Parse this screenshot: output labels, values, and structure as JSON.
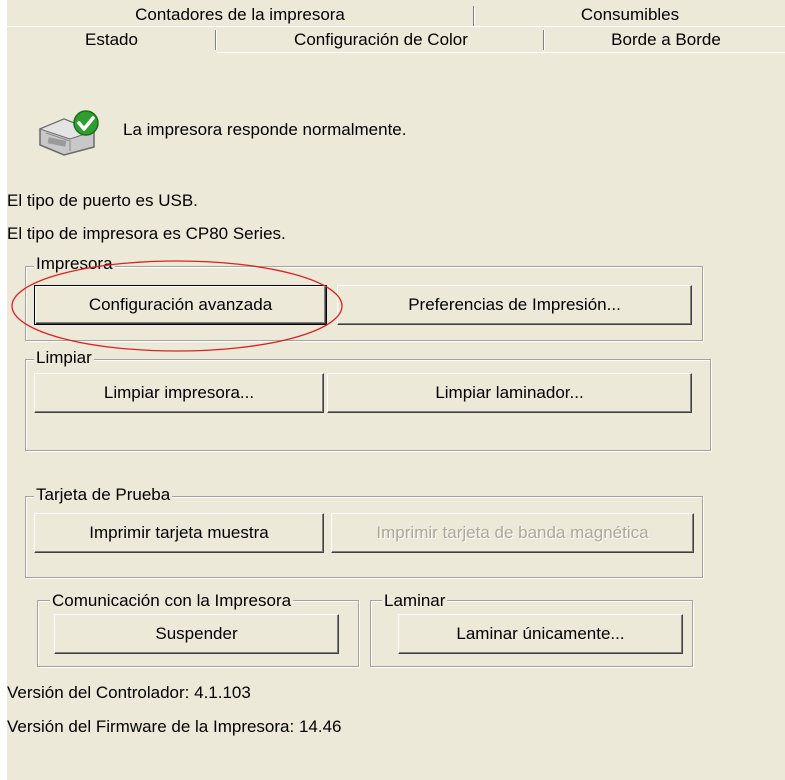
{
  "tabs_row1": [
    "Contadores de la impresora",
    "Consumibles"
  ],
  "tabs_row2": [
    "Estado",
    "Configuración de Color",
    "Borde a Borde"
  ],
  "status": {
    "message": "La impresora responde normalmente.",
    "port_type": "El tipo de puerto es USB.",
    "printer_type": "El tipo de impresora es CP80 Series."
  },
  "groups": {
    "impresora": {
      "title": "Impresora",
      "advanced_button": "Configuración avanzada",
      "preferences_button": "Preferencias de Impresión..."
    },
    "limpiar": {
      "title": "Limpiar",
      "clean_printer_button": "Limpiar impresora...",
      "clean_laminator_button": "Limpiar laminador..."
    },
    "tarjeta": {
      "title": "Tarjeta de Prueba",
      "print_sample_button": "Imprimir tarjeta muestra",
      "print_magnetic_button": "Imprimir tarjeta de banda magnética"
    },
    "comunicacion": {
      "title": "Comunicación con la Impresora",
      "suspend_button": "Suspender"
    },
    "laminar": {
      "title": "Laminar",
      "laminate_only_button": "Laminar únicamente..."
    }
  },
  "versions": {
    "driver": "Versión del Controlador:  4.1.103",
    "firmware": "Versión del Firmware de la Impresora: 14.46"
  },
  "colors": {
    "dialog_bg": "#ece9d8",
    "annotation_red": "#e02020",
    "status_check_green": "#2e9e2e"
  },
  "icons": {
    "status": "printer-ok-icon"
  }
}
